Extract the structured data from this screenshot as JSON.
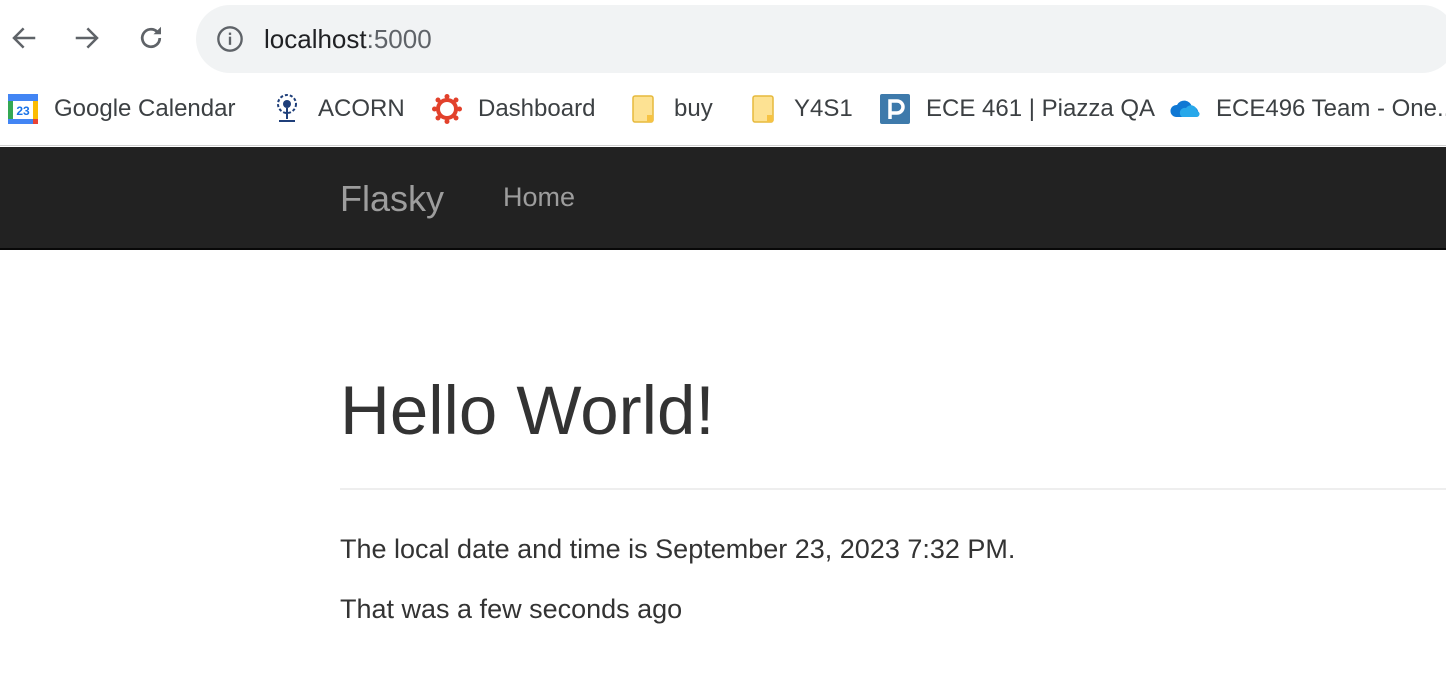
{
  "browser": {
    "url_host": "localhost",
    "url_port": ":5000",
    "icons": {
      "back": "arrow-left",
      "forward": "arrow-right",
      "reload": "reload",
      "site_info": "info-circle"
    }
  },
  "bookmarks": [
    {
      "label": "Google Calendar",
      "icon": "google-calendar-icon",
      "icon_text": "23"
    },
    {
      "label": "ACORN",
      "icon": "acorn-tree-icon"
    },
    {
      "label": "Dashboard",
      "icon": "canvas-dashboard-icon"
    },
    {
      "label": "buy",
      "icon": "folder-icon"
    },
    {
      "label": "Y4S1",
      "icon": "folder-icon"
    },
    {
      "label": "ECE 461 | Piazza QA",
      "icon": "piazza-icon"
    },
    {
      "label": "ECE496 Team - One...",
      "icon": "onedrive-cloud-icon"
    }
  ],
  "navbar": {
    "brand": "Flasky",
    "links": [
      "Home"
    ]
  },
  "main": {
    "title": "Hello World!",
    "datetime_text": "The local date and time is September 23, 2023 7:32 PM.",
    "relative_text": "That was a few seconds ago"
  },
  "colors": {
    "navbar_bg": "#222222",
    "navbar_text": "#9d9d9d",
    "body_text": "#333333",
    "omnibox_bg": "#f1f3f4"
  }
}
